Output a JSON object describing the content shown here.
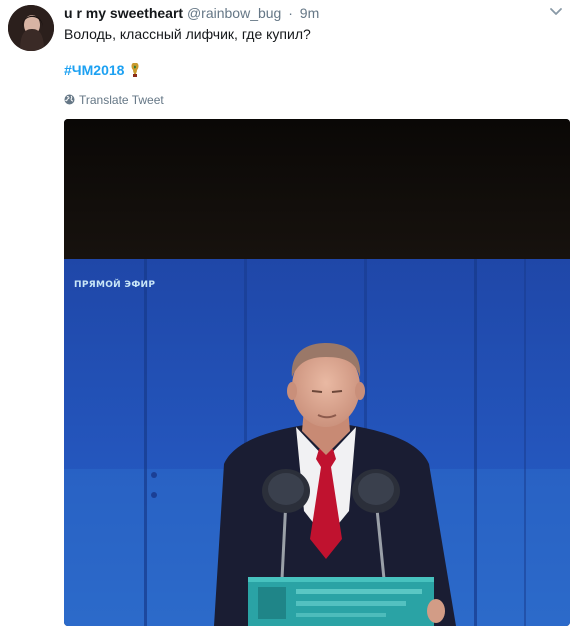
{
  "tweet": {
    "display_name": "u r my sweetheart",
    "handle": "@rainbow_bug",
    "separator": "·",
    "time": "9m",
    "text": "Володь, классный лифчик, где купил?",
    "hashtag": "#ЧМ2018",
    "translate_label": "Translate Tweet"
  },
  "media": {
    "overlay_label": "ПРЯМОЙ ЭФИР"
  },
  "icons": {
    "caret": "chevron-down-icon",
    "translate": "globe-icon",
    "hashflag": "world-cup-trophy-icon"
  },
  "colors": {
    "link": "#1da1f2",
    "secondary_text": "#657786",
    "primary_text": "#14171a"
  }
}
